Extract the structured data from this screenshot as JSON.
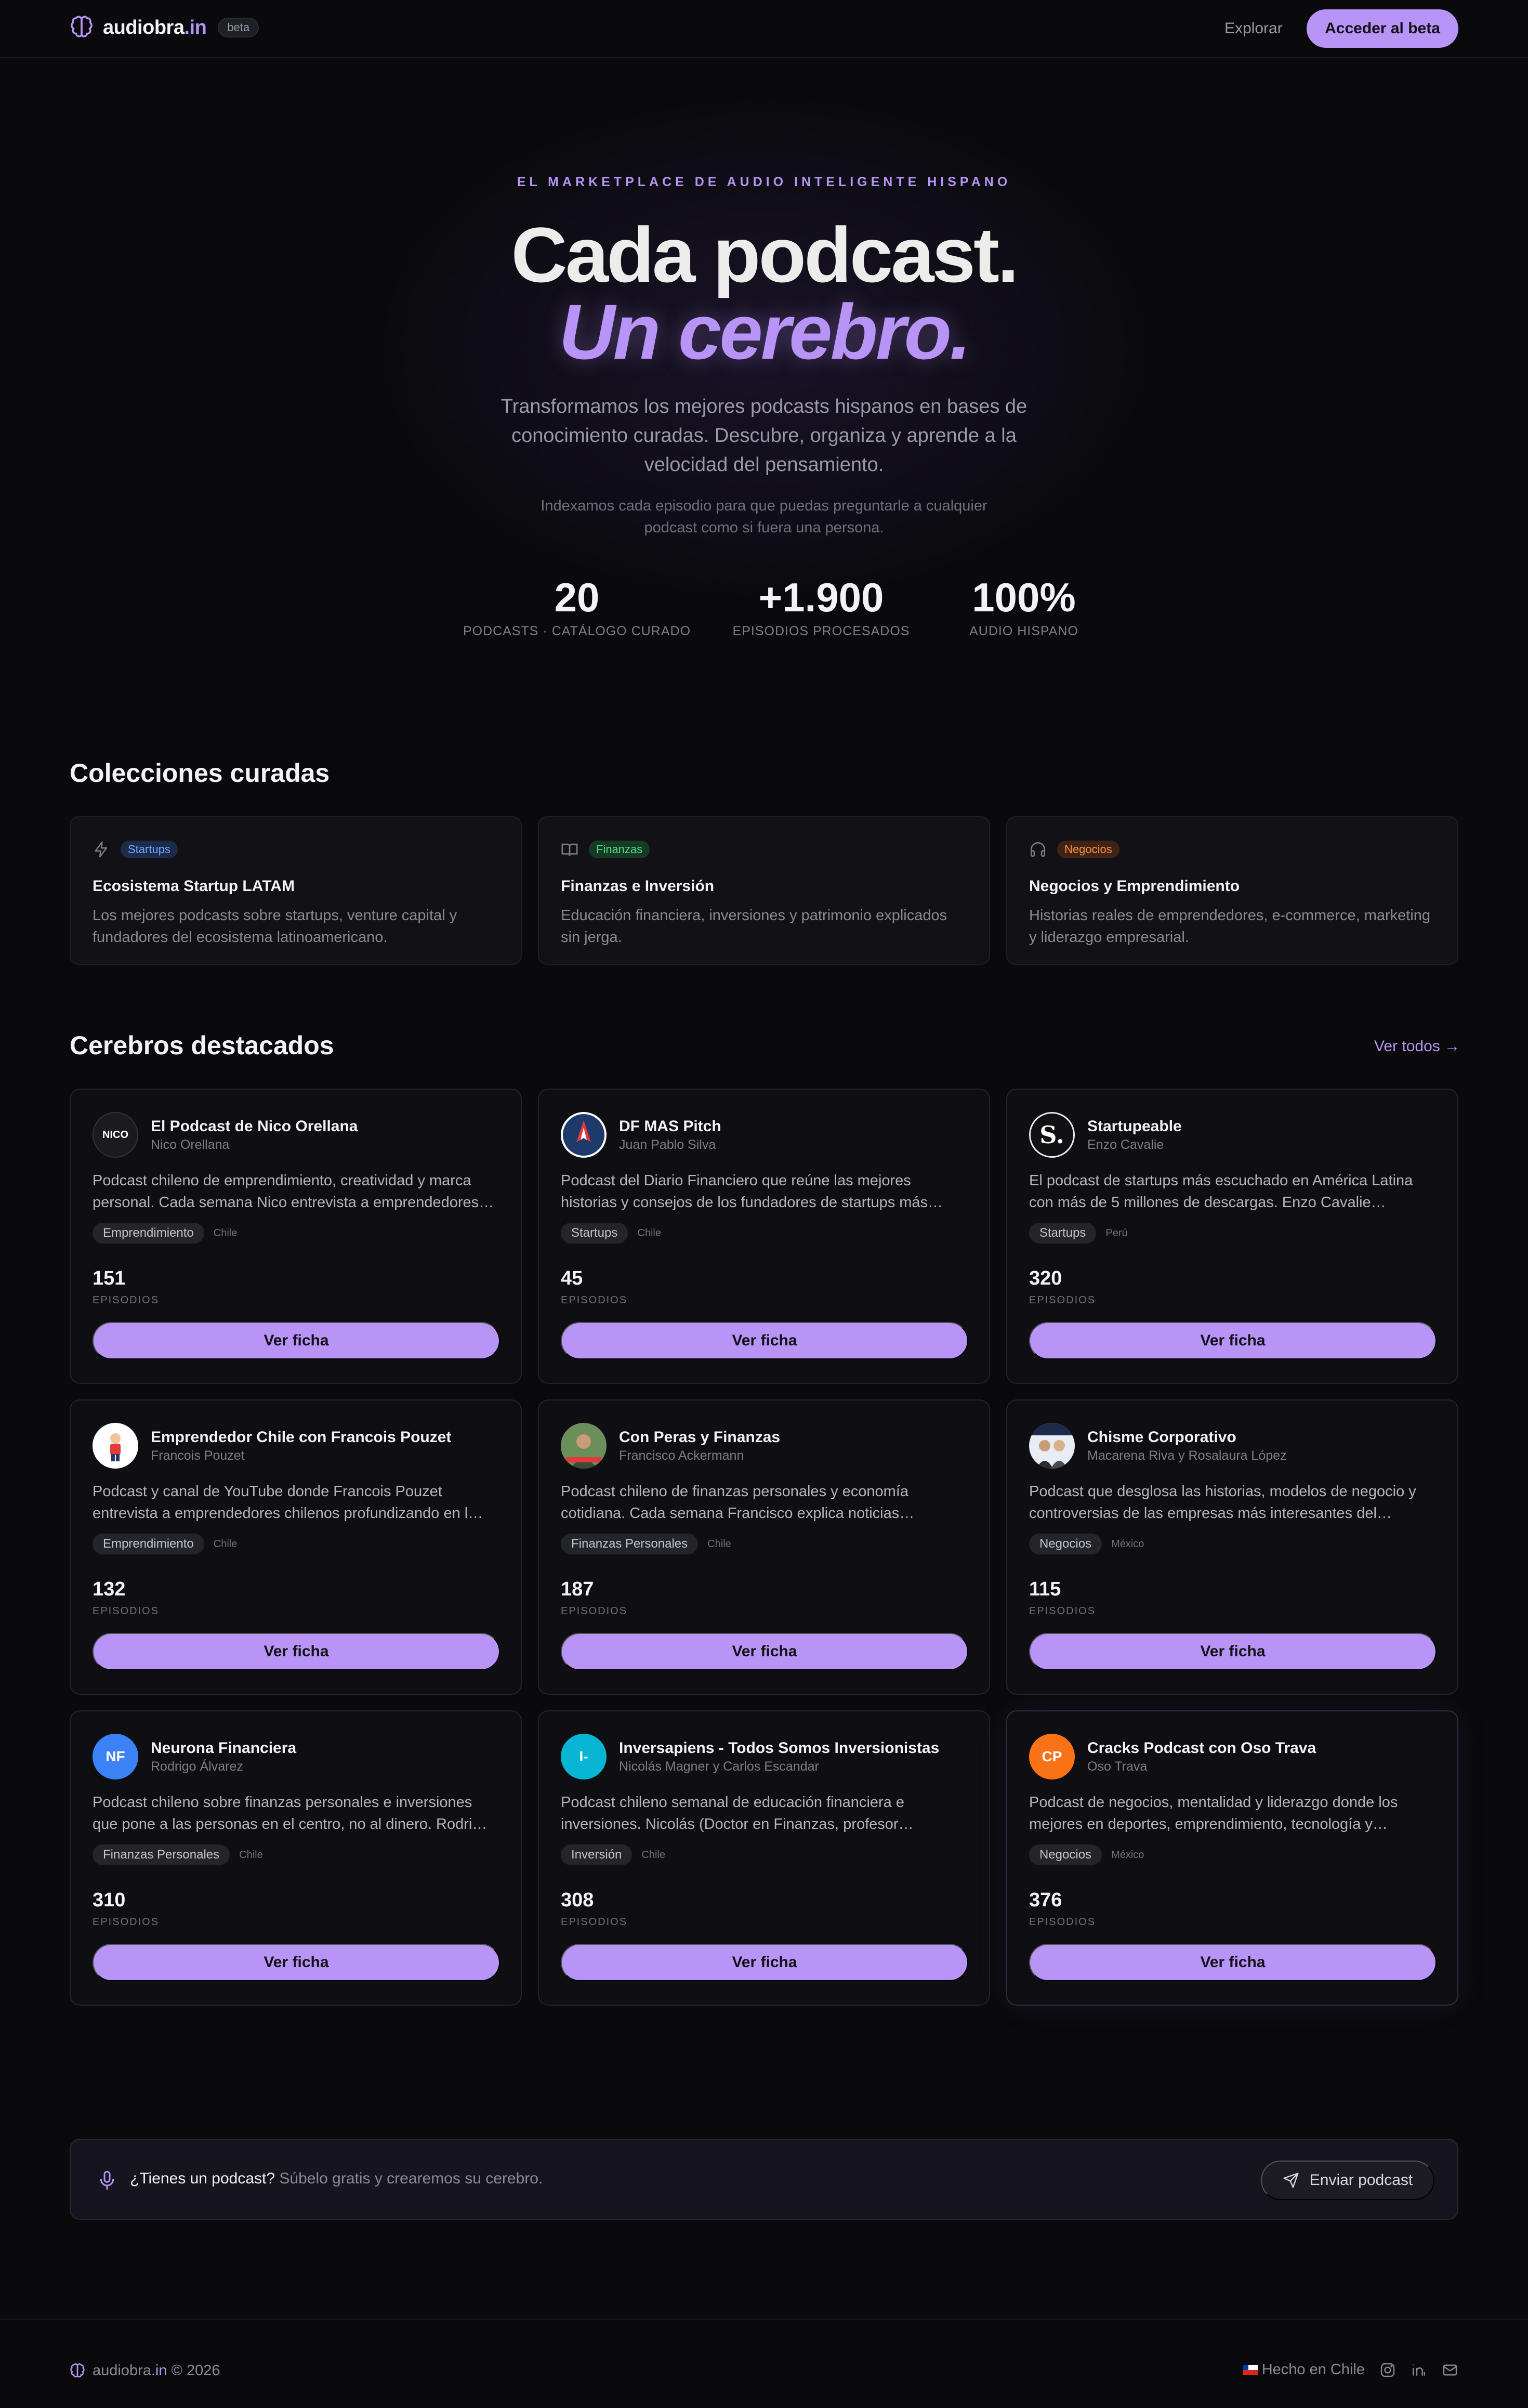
{
  "nav": {
    "logo_name": "audiobra",
    "logo_tld": ".in",
    "beta_badge": "beta",
    "explore": "Explorar",
    "cta": "Acceder al beta"
  },
  "hero": {
    "eyebrow": "EL MARKETPLACE DE AUDIO INTELIGENTE HISPANO",
    "title_line1": "Cada podcast.",
    "title_line2": "Un cerebro.",
    "subtitle": "Transformamos los mejores podcasts hispanos en bases de conocimiento curadas. Descubre, organiza y aprende a la velocidad del pensamiento.",
    "subtitle2": "Indexamos cada episodio para que puedas preguntarle a cualquier podcast como si fuera una persona.",
    "stats": [
      {
        "value": "20",
        "label": "PODCASTS · CATÁLOGO CURADO"
      },
      {
        "value": "+1.900",
        "label": "EPISODIOS PROCESADOS"
      },
      {
        "value": "100%",
        "label": "AUDIO HISPANO"
      }
    ]
  },
  "collections": {
    "heading": "Colecciones curadas",
    "items": [
      {
        "tag": "Startups",
        "icon": "lightning-icon",
        "title": "Ecosistema Startup LATAM",
        "desc": "Los mejores podcasts sobre startups, venture capital y fundadores del ecosistema latinoamericano.",
        "tag_bg": "#1c2b4a",
        "tag_color": "#6ea8fe"
      },
      {
        "tag": "Finanzas",
        "icon": "book-icon",
        "title": "Finanzas e Inversión",
        "desc": "Educación financiera, inversiones y patrimonio explicados sin jerga.",
        "tag_bg": "#163a26",
        "tag_color": "#4ade80"
      },
      {
        "tag": "Negocios",
        "icon": "headphones-icon",
        "title": "Negocios y Emprendimiento",
        "desc": "Historias reales de emprendedores, e-commerce, marketing y liderazgo empresarial.",
        "tag_bg": "#3f2314",
        "tag_color": "#fb923c"
      }
    ]
  },
  "featured": {
    "heading": "Cerebros destacados",
    "see_all": "Ver todos →",
    "episodes_label": "EPISODIOS",
    "button_label": "Ver ficha",
    "cards": [
      {
        "name": "El Podcast de Nico Orellana",
        "author": "Nico Orellana",
        "desc": "Podcast chileno de emprendimiento, creatividad y marca personal. Cada semana Nico entrevista a emprendedores…",
        "tag": "Emprendimiento",
        "country": "Chile",
        "episodes": "151",
        "avatar_text": "NICO",
        "avatar_bg": "#1b1b1f"
      },
      {
        "name": "DF MAS Pitch",
        "author": "Juan Pablo Silva",
        "desc": "Podcast del Diario Financiero que reúne las mejores historias y consejos de los fundadores de startups más…",
        "tag": "Startups",
        "country": "Chile",
        "episodes": "45",
        "avatar_text": "",
        "avatar_bg": "#ffffff"
      },
      {
        "name": "Startupeable",
        "author": "Enzo Cavalie",
        "desc": "El podcast de startups más escuchado en América Latina con más de 5 millones de descargas. Enzo Cavalie…",
        "tag": "Startups",
        "country": "Perú",
        "episodes": "320",
        "avatar_text": "S.",
        "avatar_bg": "#111114"
      },
      {
        "name": "Emprendedor Chile con Francois Pouzet",
        "author": "Francois Pouzet",
        "desc": "Podcast y canal de YouTube donde Francois Pouzet entrevista a emprendedores chilenos profundizando en l…",
        "tag": "Emprendimiento",
        "country": "Chile",
        "episodes": "132",
        "avatar_text": "",
        "avatar_bg": "#ffffff"
      },
      {
        "name": "Con Peras y Finanzas",
        "author": "Francisco Ackermann",
        "desc": "Podcast chileno de finanzas personales y economía cotidiana. Cada semana Francisco explica noticias…",
        "tag": "Finanzas Personales",
        "country": "Chile",
        "episodes": "187",
        "avatar_text": "",
        "avatar_bg": "#6b8f5a"
      },
      {
        "name": "Chisme Corporativo",
        "author": "Macarena Riva y Rosalaura López",
        "desc": "Podcast que desglosa las historias, modelos de negocio y controversias de las empresas más interesantes del…",
        "tag": "Negocios",
        "country": "México",
        "episodes": "115",
        "avatar_text": "",
        "avatar_bg": "#e8ecf4"
      },
      {
        "name": "Neurona Financiera",
        "author": "Rodrigo Álvarez",
        "desc": "Podcast chileno sobre finanzas personales e inversiones que pone a las personas en el centro, no al dinero. Rodri…",
        "tag": "Finanzas Personales",
        "country": "Chile",
        "episodes": "310",
        "avatar_text": "NF",
        "avatar_bg": "#3b82f6"
      },
      {
        "name": "Inversapiens - Todos Somos Inversionistas",
        "author": "Nicolás Magner y Carlos Escandar",
        "desc": "Podcast chileno semanal de educación financiera e inversiones. Nicolás (Doctor en Finanzas, profesor…",
        "tag": "Inversión",
        "country": "Chile",
        "episodes": "308",
        "avatar_text": "I-",
        "avatar_bg": "#06b6d4"
      },
      {
        "name": "Cracks Podcast con Oso Trava",
        "author": "Oso Trava",
        "desc": "Podcast de negocios, mentalidad y liderazgo donde los mejores en deportes, emprendimiento, tecnología y…",
        "tag": "Negocios",
        "country": "México",
        "episodes": "376",
        "avatar_text": "CP",
        "avatar_bg": "#f97316"
      }
    ]
  },
  "submit": {
    "question": "¿Tienes un podcast?",
    "prompt": "Súbelo gratis y crearemos su cerebro.",
    "button": "Enviar podcast"
  },
  "footer": {
    "brand": "audiobra",
    "brand_tld": ".in",
    "copyright": "© 2026",
    "made_in": "Hecho en Chile"
  },
  "colors": {
    "accent": "#b794f6",
    "background": "#0a0a0d",
    "card": "#0f0f13"
  }
}
